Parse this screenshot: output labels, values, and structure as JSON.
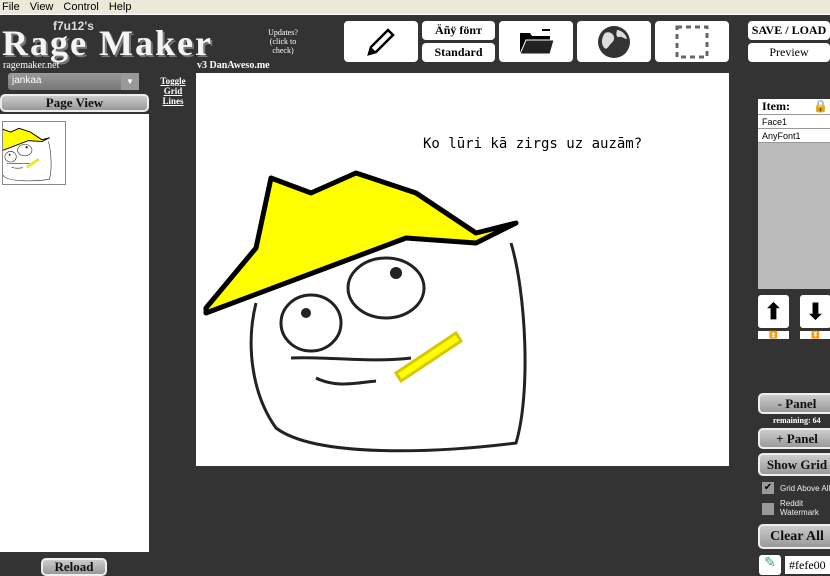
{
  "menu": [
    "File",
    "View",
    "Control",
    "Help"
  ],
  "header": {
    "subtitle": "f7u12's",
    "title": "Rage Maker",
    "site": "ragemaker.net",
    "updates": "Updates? (click to check)",
    "version": "v3  DanAweso.me"
  },
  "toolbar": {
    "pencil_icon": "pencil-icon",
    "font_top": "Äñÿ fönт",
    "font_bottom": "Standard",
    "folder_icon": "folder-icon",
    "globe_icon": "globe-icon",
    "select_icon": "dashed-square-icon",
    "save_load": "SAVE / LOAD",
    "preview": "Preview"
  },
  "left": {
    "dropdown_value": "jankaa",
    "page_view": "Page View",
    "toggle_grid": "Toggle Grid Lines",
    "reload": "Reload"
  },
  "canvas": {
    "text": "Ko lūri kā zirgs uz auzām?"
  },
  "right": {
    "item_header": "Item:",
    "items": [
      "Face1",
      "AnyFont1"
    ],
    "minus_panel": "- Panel",
    "remaining": "remaining: 64",
    "plus_panel": "+ Panel",
    "show_grid": "Show Grid",
    "grid_above": "Grid Above All",
    "grid_above_checked": true,
    "reddit_watermark": "Reddit Watermark",
    "reddit_checked": false,
    "clear_all": "Clear All",
    "color_value": "#fefe00"
  },
  "colors": {
    "background": "#333333",
    "hat": "#fefe00"
  }
}
